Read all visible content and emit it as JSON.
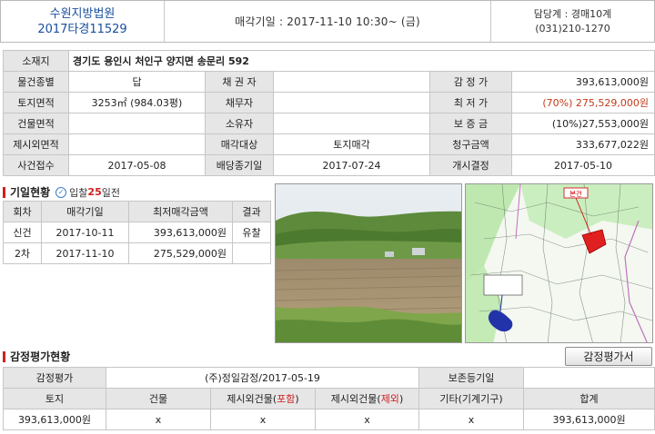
{
  "header": {
    "court": "수원지방법원",
    "case_no": "2017타경11529",
    "auction_date": "매각기일 : 2017-11-10   10:30~ (금)",
    "department": "담당계 : 경매10계",
    "phone": "(031)210-1270"
  },
  "info": {
    "address_label": "소재지",
    "address": "경기도 용인시 처인구 양지면 송문리 592",
    "property_type_label": "물건종별",
    "property_type": "답",
    "creditor_label": "채 권 자",
    "creditor": "",
    "appraisal_label": "감 정 가",
    "appraisal": "393,613,000원",
    "land_area_label": "토지면적",
    "land_area": "3253㎡ (984.03평)",
    "debtor_label": "채무자",
    "debtor": "",
    "min_price_label": "최 저 가",
    "min_price": "(70%) 275,529,000원",
    "building_area_label": "건물면적",
    "building_area": "",
    "owner_label": "소유자",
    "owner": "",
    "deposit_label": "보 증 금",
    "deposit": "(10%)27,553,000원",
    "excluded_area_label": "제시외면적",
    "excluded_area": "",
    "sale_target_label": "매각대상",
    "sale_target": "토지매각",
    "claim_label": "청구금액",
    "claim": "333,677,022원",
    "case_received_label": "사건접수",
    "case_received": "2017-05-08",
    "dividend_deadline_label": "배당종기일",
    "dividend_deadline": "2017-07-24",
    "start_decision_label": "개시결정",
    "start_decision": "2017-05-10"
  },
  "history": {
    "title": "기일현황",
    "bid_prefix": "입찰",
    "bid_days": "25",
    "bid_suffix": "일전",
    "headers": [
      "회차",
      "매각기일",
      "최저매각금액",
      "결과"
    ],
    "rows": [
      [
        "신건",
        "2017-10-11",
        "393,613,000원",
        "유찰"
      ],
      [
        "2차",
        "2017-11-10",
        "275,529,000원",
        ""
      ]
    ]
  },
  "map": {
    "marker_label": "본건"
  },
  "appraisal": {
    "title": "감정평가현황",
    "button": "감정평가서",
    "row1": {
      "label": "감정평가",
      "value": "(주)정일감정/2017-05-19",
      "label2": "보존등기일",
      "value2": ""
    },
    "headers": {
      "land": "토지",
      "building": "건물",
      "excl_incl_prefix": "제시외건물(",
      "excl_incl_mark": "포함",
      "excl_excl_prefix": "제시외건물(",
      "excl_excl_mark": "제외",
      "close": ")",
      "other": "기타(기계기구)",
      "total": "합계"
    },
    "values": {
      "land": "393,613,000원",
      "building": "x",
      "excl_incl": "x",
      "excl_excl": "x",
      "other": "x",
      "total": "393,613,000원"
    }
  },
  "colors": {
    "court_blue": "#1a4fa0",
    "accent_red": "#d02020",
    "label_gray": "#e6e6e6"
  }
}
